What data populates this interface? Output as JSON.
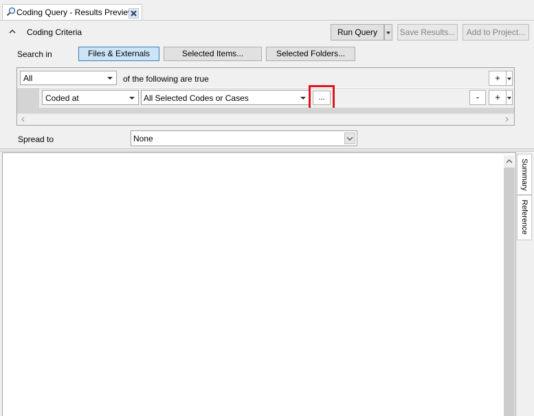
{
  "tab": {
    "title": "Coding Query - Results Preview",
    "icon": "magnifier-icon",
    "close_icon": "close-icon"
  },
  "criteria_header": {
    "title": "Coding Criteria",
    "collapse_icon": "chevron-up-icon"
  },
  "toolbar": {
    "run_query": "Run Query",
    "save_results": "Save Results...",
    "add_to_project": "Add to Project..."
  },
  "search_in": {
    "label": "Search in",
    "options": [
      "Files & Externals",
      "Selected Items...",
      "Selected Folders..."
    ],
    "selected": "Files & Externals"
  },
  "criteria": {
    "match_value": "All",
    "match_suffix": "of the following are true",
    "row": {
      "condition": "Coded at",
      "target": "All Selected Codes or Cases",
      "browse_label": "...",
      "minus_label": "-",
      "plus_label": "+"
    },
    "add_label": "+"
  },
  "spread": {
    "label": "Spread to",
    "value": "None"
  },
  "side_tabs": [
    "Summary",
    "Reference"
  ],
  "colors": {
    "highlight_box": "#e0141e",
    "selected_button": "#cce4f7",
    "tab_close_bg": "#dfe7f1"
  }
}
